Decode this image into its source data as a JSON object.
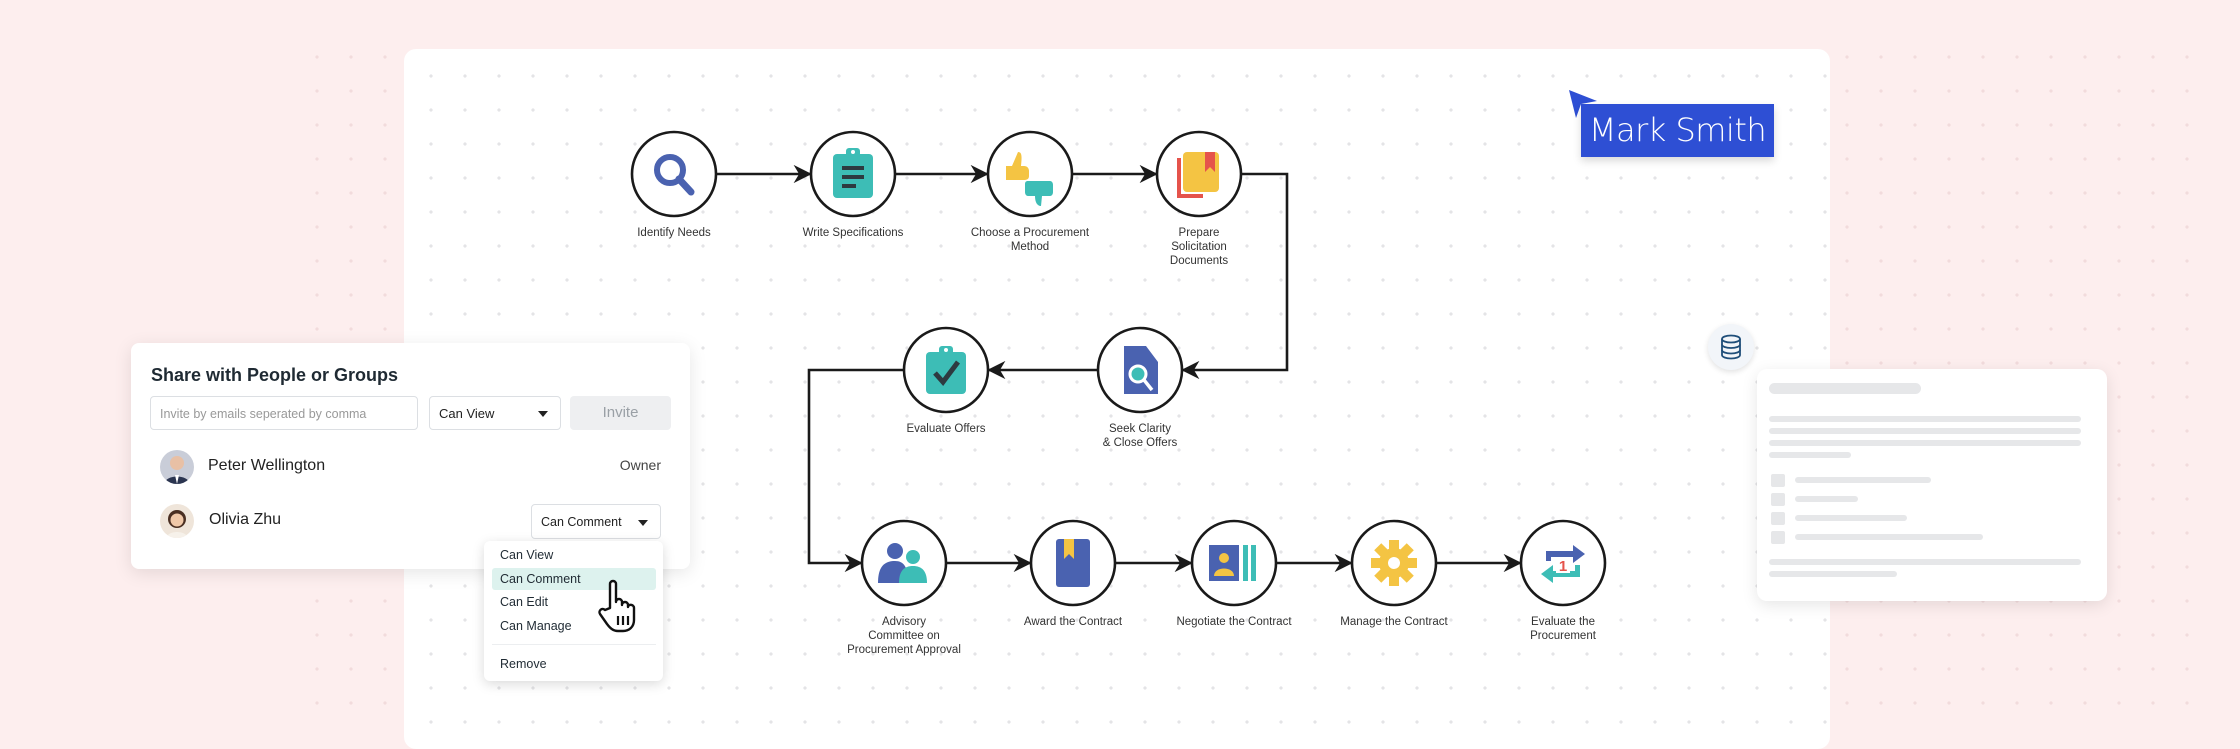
{
  "collaborator_cursor": {
    "name": "Mark Smith",
    "color": "#2e4fd4"
  },
  "flow": {
    "nodes": [
      {
        "id": "identify-needs",
        "label": [
          "Identify Needs"
        ],
        "icon": "magnifier-icon"
      },
      {
        "id": "write-specifications",
        "label": [
          "Write Specifications"
        ],
        "icon": "clipboard-list-icon"
      },
      {
        "id": "choose-method",
        "label": [
          "Choose a Procurement",
          "Method"
        ],
        "icon": "thumbs-up-down-icon"
      },
      {
        "id": "prepare-docs",
        "label": [
          "Prepare",
          "Solicitation",
          "Documents"
        ],
        "icon": "bookmark-book-icon"
      },
      {
        "id": "seek-clarity",
        "label": [
          "Seek Clarity",
          "& Close Offers"
        ],
        "icon": "document-search-icon"
      },
      {
        "id": "evaluate-offers",
        "label": [
          "Evaluate Offers"
        ],
        "icon": "clipboard-check-icon"
      },
      {
        "id": "advisory-committee",
        "label": [
          "Advisory",
          "Committee on",
          "Procurement Approval"
        ],
        "icon": "people-icon"
      },
      {
        "id": "award-contract",
        "label": [
          "Award the Contract"
        ],
        "icon": "book-icon"
      },
      {
        "id": "negotiate-contract",
        "label": [
          "Negotiate the Contract"
        ],
        "icon": "id-card-icon"
      },
      {
        "id": "manage-contract",
        "label": [
          "Manage the Contract"
        ],
        "icon": "gear-icon"
      },
      {
        "id": "evaluate-procurement",
        "label": [
          "Evaluate the",
          "Procurement"
        ],
        "icon": "repeat-one-icon"
      }
    ],
    "colors": {
      "blue": "#4a62b0",
      "teal": "#3dbdb6",
      "yellow": "#f4c443",
      "red": "#e5534b",
      "stroke": "#1a1a1a"
    }
  },
  "share_dialog": {
    "title": "Share with People or Groups",
    "invite_placeholder": "Invite by emails seperated by comma",
    "permission_select": "Can View",
    "invite_button": "Invite",
    "people": [
      {
        "name": "Peter Wellington",
        "role": "Owner"
      },
      {
        "name": "Olivia Zhu",
        "role": "Can Comment"
      }
    ],
    "menu": {
      "items": [
        "Can View",
        "Can Comment",
        "Can Edit",
        "Can Manage"
      ],
      "selected": "Can Comment",
      "remove": "Remove"
    }
  }
}
